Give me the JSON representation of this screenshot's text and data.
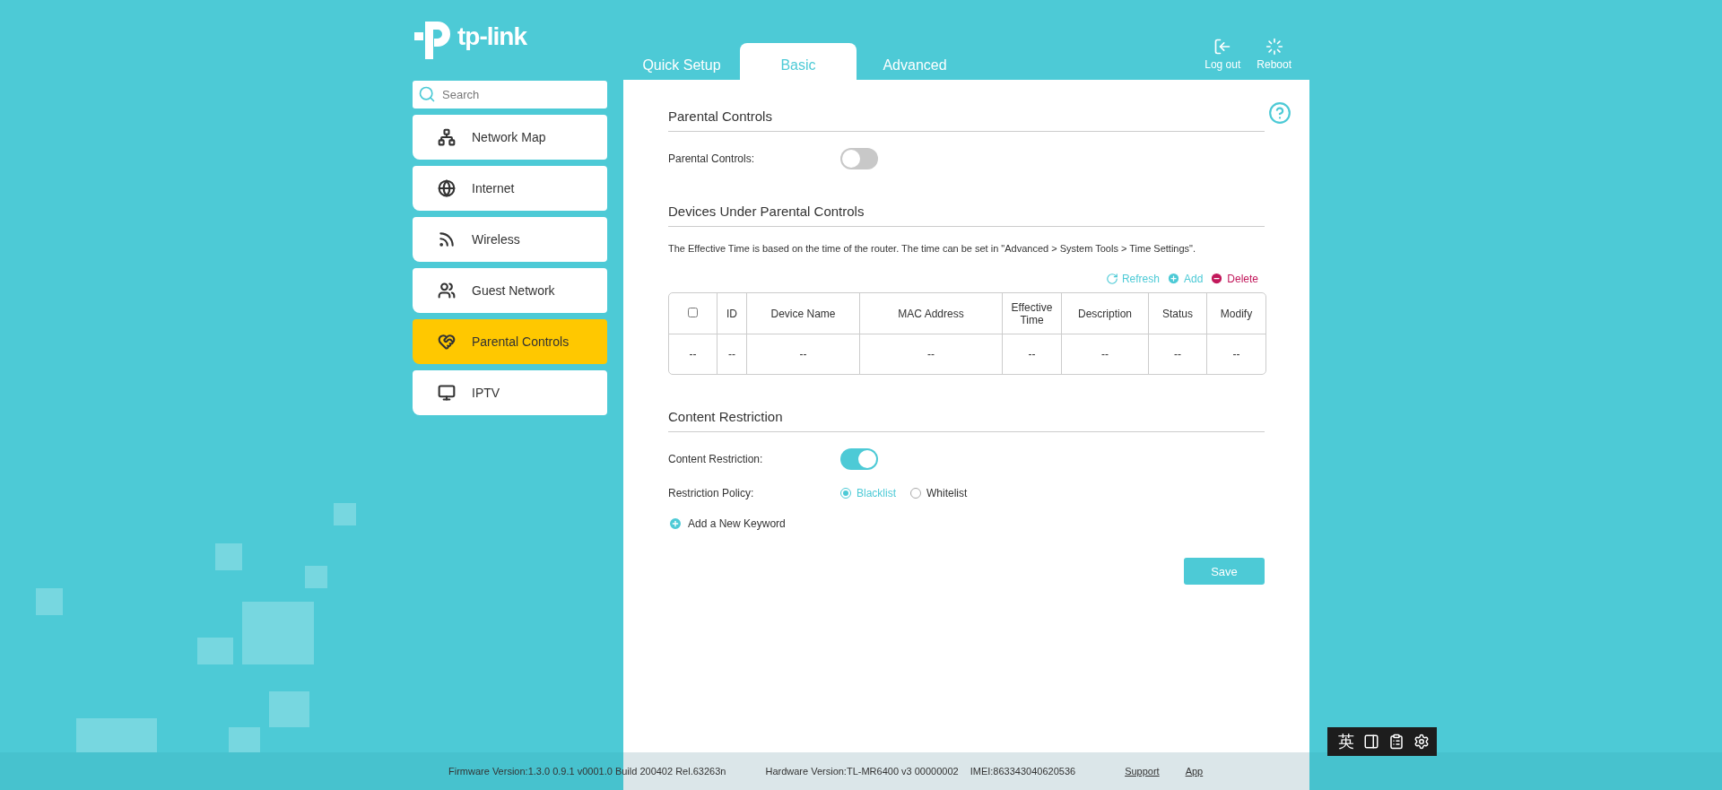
{
  "logo": {
    "text": "tp-link"
  },
  "tabs": [
    {
      "label": "Quick Setup",
      "selected": false
    },
    {
      "label": "Basic",
      "selected": true
    },
    {
      "label": "Advanced",
      "selected": false
    }
  ],
  "actions": [
    {
      "kind": "logout",
      "label": "Log out"
    },
    {
      "kind": "reboot",
      "label": "Reboot"
    }
  ],
  "sidebar": {
    "search": {
      "placeholder": "Search"
    },
    "items": [
      {
        "label": "Network Map",
        "selected": false
      },
      {
        "label": "Internet",
        "selected": false
      },
      {
        "label": "Wireless",
        "selected": false
      },
      {
        "label": "Guest Network",
        "selected": false
      },
      {
        "label": "Parental Controls",
        "selected": true
      },
      {
        "label": "IPTV",
        "selected": false
      }
    ]
  },
  "sections": [
    {
      "kind": "settings",
      "title": "Parental Controls",
      "rows": [
        {
          "kind": "toggle",
          "label": "Parental Controls:",
          "on": false
        }
      ]
    },
    {
      "kind": "table",
      "title": "Devices Under Parental Controls",
      "note": "The Effective Time is based on the time of the router. The time can be set in \"Advanced > System Tools > Time Settings\".",
      "table_actions": [
        {
          "kind": "refresh",
          "label": "Refresh"
        },
        {
          "kind": "add",
          "label": "Add"
        },
        {
          "kind": "delete",
          "label": "Delete"
        }
      ],
      "table": {
        "select_all": {
          "checked": false
        },
        "columns": [
          "",
          "ID",
          "Device Name",
          "MAC Address",
          "Effective Time",
          "Description",
          "Status",
          "Modify"
        ],
        "rows": [
          {
            "cells": [
              "--",
              "--",
              "--",
              "--",
              "--",
              "--",
              "--",
              "--"
            ]
          }
        ]
      }
    },
    {
      "kind": "settings",
      "title": "Content Restriction",
      "rows": [
        {
          "kind": "toggle",
          "label": "Content Restriction:",
          "on": true
        },
        {
          "kind": "radio",
          "label": "Restriction Policy:",
          "options": [
            {
              "label": "Blacklist",
              "selected": true
            },
            {
              "label": "Whitelist",
              "selected": false
            }
          ]
        }
      ],
      "add_link": "Add a New Keyword"
    }
  ],
  "save_button": "Save",
  "footer": {
    "firmware": "Firmware Version:1.3.0 0.9.1 v0001.0 Build 200402 Rel.63263n",
    "hardware": "Hardware Version:TL-MR6400 v3 00000002",
    "imei": "IMEI:863343040620536",
    "links": [
      "Support",
      "App"
    ]
  },
  "ime_toolbar": {
    "label": "英"
  }
}
